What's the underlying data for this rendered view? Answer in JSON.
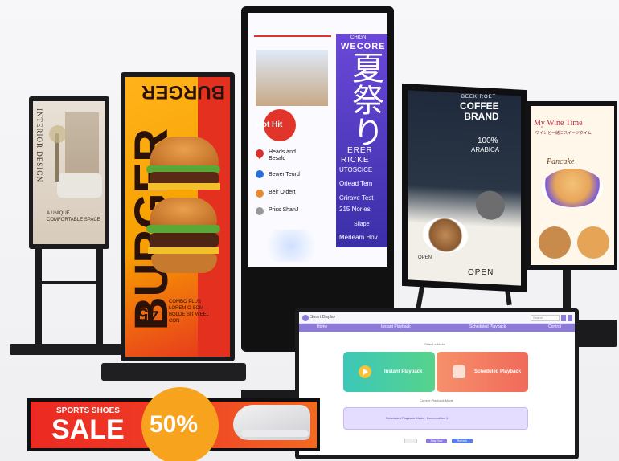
{
  "kiosk_interior": {
    "title": "INTERIOR DESIGN",
    "caption": "A UNIQUE COMFORTABLE SPACE"
  },
  "kiosk_burger": {
    "top_text": "BURGER",
    "vertical_text": "BURGER",
    "price": "45",
    "small_text": "COMBO PLUS\nLOREM O SOM\nBOLDE SIT WEEL\nCON"
  },
  "kiosk_center": {
    "badge": "Hot Hit",
    "blue_small": "CHIGN",
    "blue_title": "WECORE",
    "blue_kanji": "夏祭り",
    "blue_line1": "ERER",
    "blue_line2": "RICKE",
    "blue_line3": "UTOSCICE",
    "blue_items": [
      "Oriead Tem",
      "Crirave Test",
      "215 Norles",
      "Sliape",
      "Merleam Hov"
    ],
    "left_items": [
      "Heads and\nBesald",
      "BewenTeurd",
      "Beir Oldert",
      "Priss ShanJ"
    ]
  },
  "kiosk_coffee": {
    "top": "BEEK ROET",
    "title": "COFFEE\nBRAND",
    "percent": "100%",
    "sub": "ARABICA",
    "bottom_left": "OPEN",
    "bottom": "OPEN"
  },
  "kiosk_wine": {
    "title": "My Wine Time",
    "subtitle": "ワインと一緒にスイーツタイム",
    "section": "Pancake"
  },
  "monitor": {
    "app_name": "Smart Display",
    "search_placeholder": "Search",
    "nav": [
      "Home",
      "Instant Playback",
      "Scheduled Playback",
      "Control"
    ],
    "section_label": "Select a Mode",
    "instant_label": "Instant Playback",
    "scheduled_label": "Scheduled Playback",
    "current_label": "Current Playback Mode",
    "current_value": "Scheduled Playback Mode : Commodities 1",
    "footer_buttons": [
      "Play Now",
      "Refresh"
    ]
  },
  "sale_banner": {
    "top": "SPORTS SHOES",
    "main": "SALE",
    "percent": "50%"
  },
  "colors": {
    "nav_purple": "#8e7bd9",
    "instant_teal": "#3cc7b8",
    "sched_coral": "#f06a5a",
    "sale_red": "#ec2a23",
    "sale_orange": "#f7a31d"
  }
}
